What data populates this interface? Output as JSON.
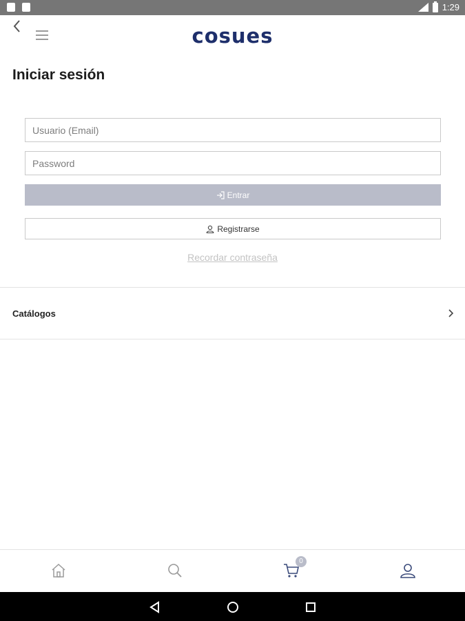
{
  "status_bar": {
    "time": "1:29",
    "icons": [
      "notification-icon",
      "notification-icon",
      "signal-icon",
      "battery-icon"
    ]
  },
  "header": {
    "logo_text": "cosues",
    "back_icon": "chevron-left-icon",
    "menu_icon": "hamburger-icon"
  },
  "page": {
    "title": "Iniciar sesión"
  },
  "login_form": {
    "email_placeholder": "Usuario (Email)",
    "email_value": "",
    "password_placeholder": "Password",
    "password_value": "",
    "enter_label": "Entrar",
    "enter_icon": "sign-in-icon",
    "register_label": "Registrarse",
    "register_icon": "user-icon",
    "forgot_label": "Recordar contraseña"
  },
  "catalog": {
    "label": "Catálogos",
    "icon": "chevron-right-icon"
  },
  "bottom_nav": {
    "items": [
      {
        "name": "home",
        "icon": "home-icon"
      },
      {
        "name": "search",
        "icon": "search-icon"
      },
      {
        "name": "cart",
        "icon": "cart-icon",
        "badge": "0"
      },
      {
        "name": "account",
        "icon": "user-icon"
      }
    ]
  },
  "android_nav": {
    "buttons": [
      "back-triangle-icon",
      "home-circle-icon",
      "recents-square-icon"
    ]
  },
  "colors": {
    "brand": "#1e2f6b",
    "button_disabled": "#b9bcc9",
    "status_bar": "#767676",
    "nav_icons": "#9a9a9a"
  }
}
